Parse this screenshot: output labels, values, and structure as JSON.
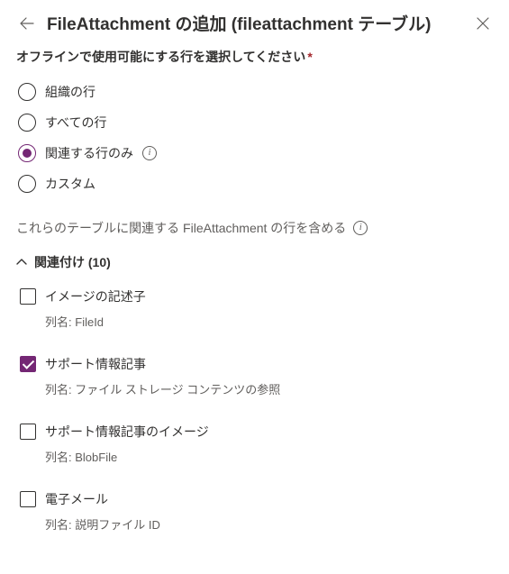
{
  "header": {
    "title": "FileAttachment の追加 (fileattachment テーブル)"
  },
  "instruction": "オフラインで使用可能にする行を選択してください",
  "radios": {
    "org": "組織の行",
    "all": "すべての行",
    "related": "関連する行のみ",
    "custom": "カスタム"
  },
  "subtext": "これらのテーブルに関連する FileAttachment の行を含める",
  "section": {
    "label": "関連付け (10)"
  },
  "col_prefix": "列名:",
  "items": [
    {
      "title": "イメージの記述子",
      "col": "FileId",
      "checked": false
    },
    {
      "title": "サポート情報記事",
      "col": "ファイル ストレージ コンテンツの参照",
      "checked": true
    },
    {
      "title": "サポート情報記事のイメージ",
      "col": "BlobFile",
      "checked": false
    },
    {
      "title": "電子メール",
      "col": "説明ファイル ID",
      "checked": false
    }
  ]
}
